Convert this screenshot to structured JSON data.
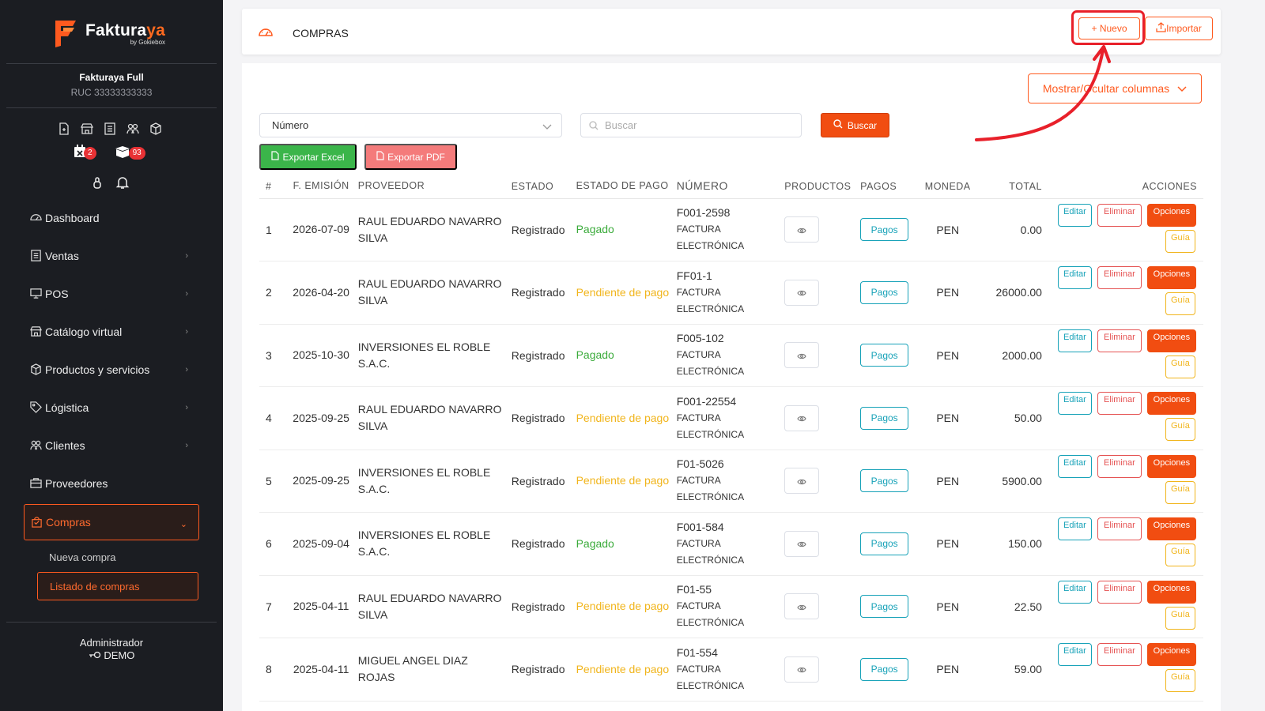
{
  "brand": {
    "name_part1": "Faktura",
    "name_part2": "ya",
    "byline": "by Gokiebox"
  },
  "company": {
    "name": "Fakturaya Full",
    "ruc": "RUC 33333333333"
  },
  "badges": {
    "calendar_count": "2",
    "box_count": "93"
  },
  "menu": [
    {
      "label": "Dashboard",
      "icon": "dashboard-icon"
    },
    {
      "label": "Ventas",
      "icon": "receipt-icon"
    },
    {
      "label": "POS",
      "icon": "monitor-icon"
    },
    {
      "label": "Catálogo virtual",
      "icon": "store-icon"
    },
    {
      "label": "Productos y servicios",
      "icon": "cube-icon"
    },
    {
      "label": "Lógistica",
      "icon": "tag-icon"
    },
    {
      "label": "Clientes",
      "icon": "users-icon"
    },
    {
      "label": "Proveedores",
      "icon": "briefcase-icon"
    },
    {
      "label": "Compras",
      "icon": "bag-icon"
    }
  ],
  "submenu": [
    {
      "label": "Nueva compra"
    },
    {
      "label": "Listado de compras"
    }
  ],
  "user": {
    "role": "Administrador",
    "name": "DEMO"
  },
  "header": {
    "title": "COMPRAS",
    "nuevo_label": "+ Nuevo",
    "importar_label": "Importar"
  },
  "toolbar": {
    "columns_label": "Mostrar/Ocultar columnas",
    "filter_select": "Número",
    "search_placeholder": "Buscar",
    "search_button": "Buscar",
    "excel_button": "Exportar Excel",
    "pdf_button": "Exportar PDF"
  },
  "table": {
    "headers": [
      "#",
      "F. EMISIÓN",
      "PROVEEDOR",
      "ESTADO",
      "ESTADO DE PAGO",
      "NÚMERO",
      "PRODUCTOS",
      "PAGOS",
      "MONEDA",
      "TOTAL",
      "ACCIONES"
    ],
    "action_labels": {
      "pagos": "Pagos",
      "editar": "Editar",
      "eliminar": "Eliminar",
      "opciones": "Opciones",
      "guia": "Guía"
    },
    "rows": [
      {
        "n": "1",
        "fecha": "2026-07-09",
        "proveedor": "RAUL EDUARDO NAVARRO SILVA",
        "estado": "Registrado",
        "pago": "Pagado",
        "pago_status": "paid",
        "numero": "F001-2598",
        "tipo": "FACTURA ELECTRÓNICA",
        "moneda": "PEN",
        "total": "0.00"
      },
      {
        "n": "2",
        "fecha": "2026-04-20",
        "proveedor": "RAUL EDUARDO NAVARRO SILVA",
        "estado": "Registrado",
        "pago": "Pendiente de pago",
        "pago_status": "pending",
        "numero": "FF01-1",
        "tipo": "FACTURA ELECTRÓNICA",
        "moneda": "PEN",
        "total": "26000.00"
      },
      {
        "n": "3",
        "fecha": "2025-10-30",
        "proveedor": "INVERSIONES EL ROBLE S.A.C.",
        "estado": "Registrado",
        "pago": "Pagado",
        "pago_status": "paid",
        "numero": "F005-102",
        "tipo": "FACTURA ELECTRÓNICA",
        "moneda": "PEN",
        "total": "2000.00"
      },
      {
        "n": "4",
        "fecha": "2025-09-25",
        "proveedor": "RAUL EDUARDO NAVARRO SILVA",
        "estado": "Registrado",
        "pago": "Pendiente de pago",
        "pago_status": "pending",
        "numero": "F001-22554",
        "tipo": "FACTURA ELECTRÓNICA",
        "moneda": "PEN",
        "total": "50.00"
      },
      {
        "n": "5",
        "fecha": "2025-09-25",
        "proveedor": "INVERSIONES EL ROBLE S.A.C.",
        "estado": "Registrado",
        "pago": "Pendiente de pago",
        "pago_status": "pending",
        "numero": "F01-5026",
        "tipo": "FACTURA ELECTRÓNICA",
        "moneda": "PEN",
        "total": "5900.00"
      },
      {
        "n": "6",
        "fecha": "2025-09-04",
        "proveedor": "INVERSIONES EL ROBLE S.A.C.",
        "estado": "Registrado",
        "pago": "Pagado",
        "pago_status": "paid",
        "numero": "F001-584",
        "tipo": "FACTURA ELECTRÓNICA",
        "moneda": "PEN",
        "total": "150.00"
      },
      {
        "n": "7",
        "fecha": "2025-04-11",
        "proveedor": "RAUL EDUARDO NAVARRO SILVA",
        "estado": "Registrado",
        "pago": "Pendiente de pago",
        "pago_status": "pending",
        "numero": "F01-55",
        "tipo": "FACTURA ELECTRÓNICA",
        "moneda": "PEN",
        "total": "22.50"
      },
      {
        "n": "8",
        "fecha": "2025-04-11",
        "proveedor": "MIGUEL ANGEL DIAZ ROJAS",
        "estado": "Registrado",
        "pago": "Pendiente de pago",
        "pago_status": "pending",
        "numero": "F01-554",
        "tipo": "FACTURA ELECTRÓNICA",
        "moneda": "PEN",
        "total": "59.00"
      }
    ]
  },
  "colors": {
    "accent": "#f14d11",
    "sidebar_bg": "#1b1d22",
    "paid": "#3bab3b",
    "pending": "#f1b51c",
    "info": "#17a2b8",
    "danger": "#e55353",
    "annotation": "#e8202a"
  }
}
